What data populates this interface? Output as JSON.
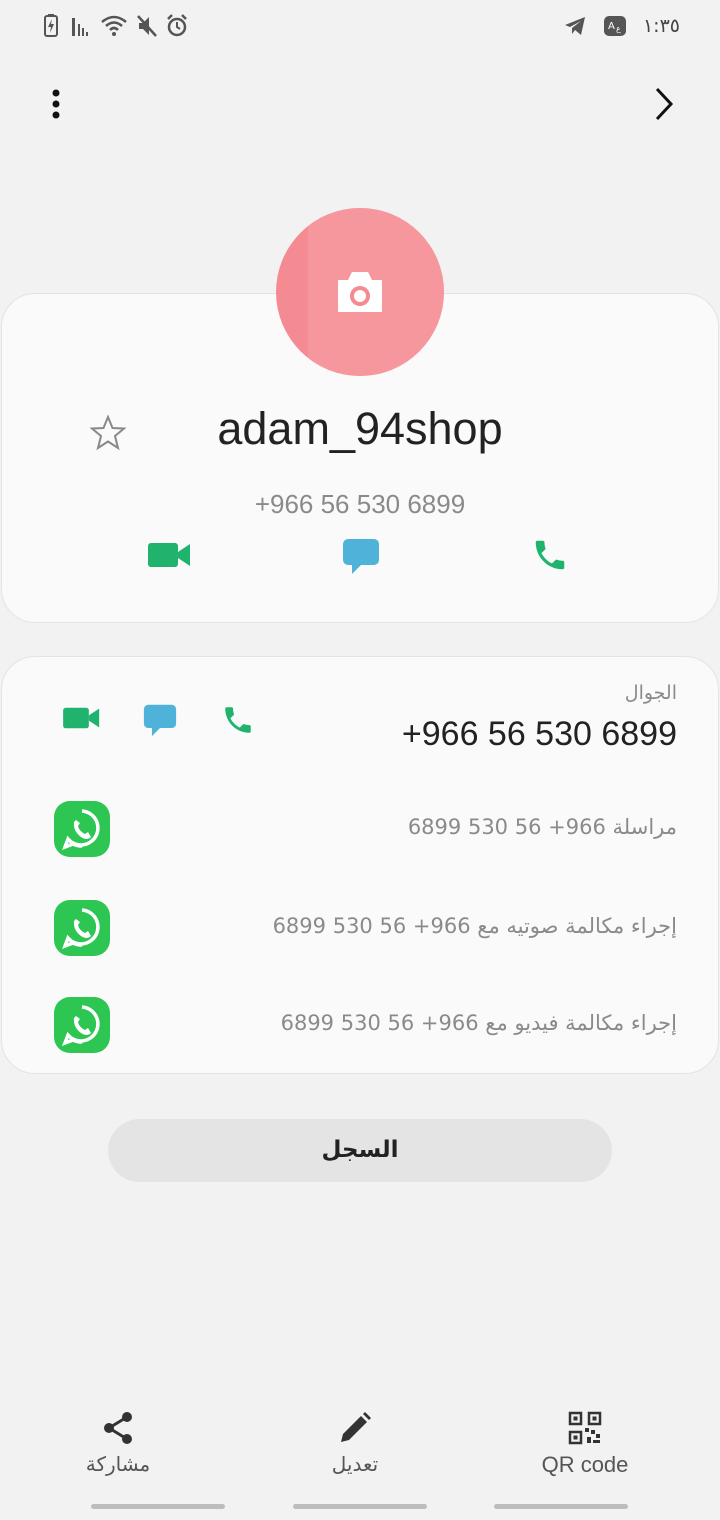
{
  "status_bar": {
    "time": "١:٣٥",
    "left_icons": [
      "battery-charging-icon",
      "signal-icon",
      "wifi-icon",
      "mute-icon",
      "alarm-icon"
    ],
    "right_icons": [
      "telegram-icon",
      "translate-icon"
    ]
  },
  "top_bar": {
    "more_icon": "more-vertical-icon",
    "forward_icon": "chevron-right-icon"
  },
  "contact": {
    "name": "adam_94shop",
    "phone": "+966 56 530 6899",
    "avatar_color": "#f48b93"
  },
  "details": {
    "mobile_label": "الجوال",
    "mobile_number": "+966 56 530 6899",
    "whatsapp_rows": [
      {
        "text": "مراسلة 966+ 56 530 6899"
      },
      {
        "text": "إجراء مكالمة صوتيه مع 966+ 56 530 6899"
      },
      {
        "text": "إجراء مكالمة فيديو مع 966+ 56 530 6899"
      }
    ]
  },
  "log_button": "السجل",
  "bottom_nav": {
    "share": "مشاركة",
    "edit": "تعديل",
    "qr": "QR code"
  },
  "colors": {
    "green": "#1fb36d",
    "blue": "#4fb3d9",
    "whatsapp": "#2dc653"
  }
}
